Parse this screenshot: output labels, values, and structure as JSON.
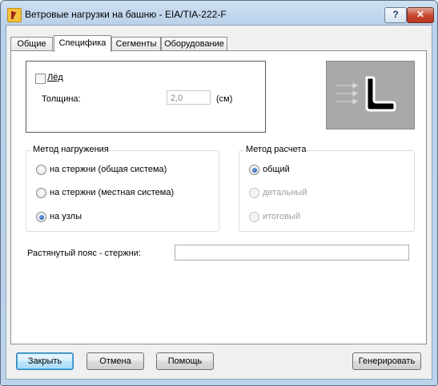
{
  "window": {
    "title": "Ветровые нагрузки на башню - EIA/TIA-222-F",
    "help_label": "?",
    "close_label": "✕"
  },
  "tabs": [
    {
      "label": "Общие",
      "active": false
    },
    {
      "label": "Специфика",
      "active": true
    },
    {
      "label": "Сегменты",
      "active": false
    },
    {
      "label": "Оборудование",
      "active": false
    }
  ],
  "ice": {
    "checkbox_label": "Лёд",
    "checked": false,
    "thickness_label": "Толщина:",
    "thickness_value": "2,0",
    "thickness_unit": "(см)"
  },
  "preview": {
    "icon": "angle-section-with-wind-arrows-icon"
  },
  "load_method": {
    "title": "Метод нагружения",
    "options": [
      {
        "label": "на стержни (общая система)",
        "selected": false
      },
      {
        "label": "на стержни (местная система)",
        "selected": false
      },
      {
        "label": "на узлы",
        "selected": true
      }
    ]
  },
  "calc_method": {
    "title": "Метод расчета",
    "options": [
      {
        "label": "общий",
        "selected": true,
        "enabled": true
      },
      {
        "label": "детальный",
        "selected": false,
        "enabled": false
      },
      {
        "label": "итоговый",
        "selected": false,
        "enabled": false
      }
    ]
  },
  "tension_chord": {
    "label": "Растянутый пояс - стержни:",
    "value": ""
  },
  "buttons": {
    "close": "Закрыть",
    "cancel": "Отмена",
    "help": "Помощь",
    "generate": "Генерировать"
  }
}
